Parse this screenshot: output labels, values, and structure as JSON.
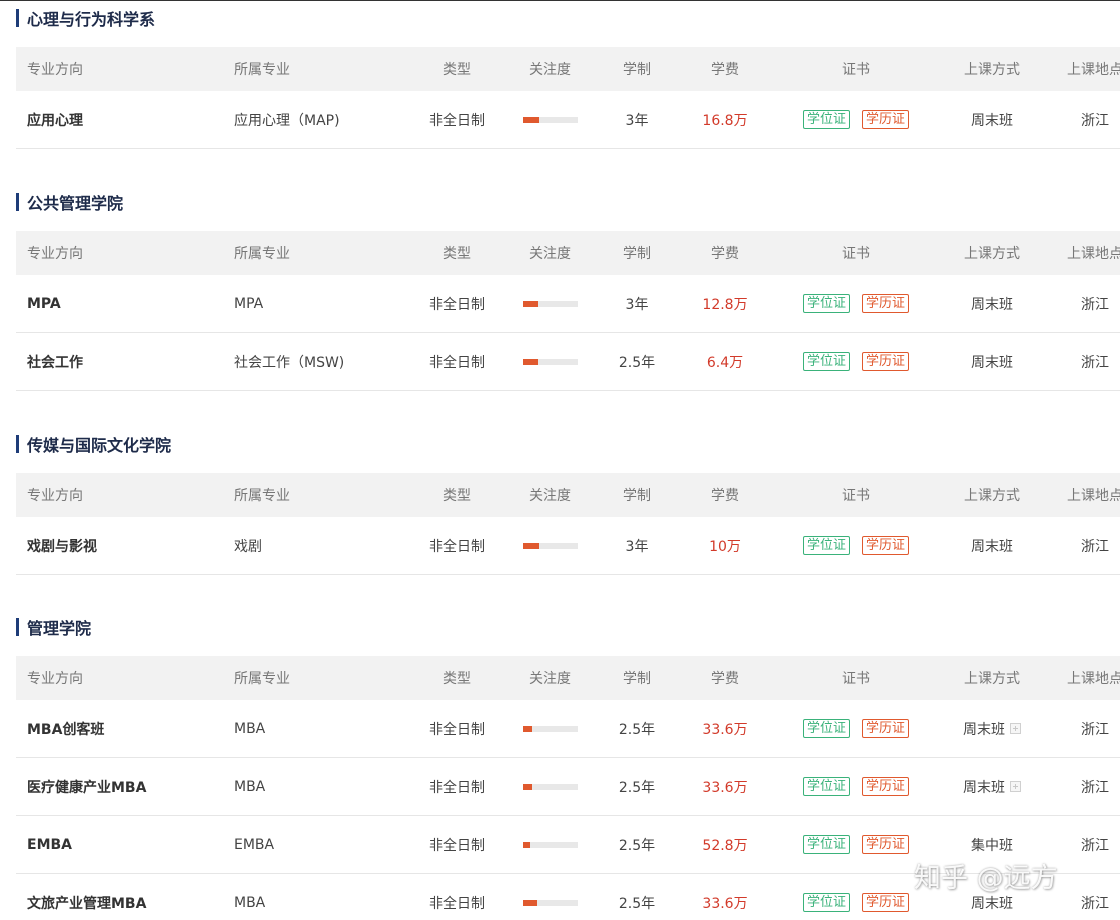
{
  "headers": {
    "direction": "专业方向",
    "major": "所属专业",
    "type": "类型",
    "attention": "关注度",
    "duration": "学制",
    "fee": "学费",
    "certificate": "证书",
    "class_mode": "上课方式",
    "location": "上课地点"
  },
  "badges": {
    "degree": "学位证",
    "education": "学历证"
  },
  "sections": [
    {
      "title": "心理与行为科学系",
      "rows": [
        {
          "direction": "应用心理",
          "major": "应用心理（MAP)",
          "type": "非全日制",
          "attention": 0.3,
          "duration": "3年",
          "fee": "16.8万",
          "class_mode": "周末班",
          "location": "浙江"
        }
      ]
    },
    {
      "title": "公共管理学院",
      "rows": [
        {
          "direction": "MPA",
          "major": "MPA",
          "type": "非全日制",
          "attention": 0.28,
          "duration": "3年",
          "fee": "12.8万",
          "class_mode": "周末班",
          "location": "浙江"
        },
        {
          "direction": "社会工作",
          "major": "社会工作（MSW)",
          "type": "非全日制",
          "attention": 0.28,
          "duration": "2.5年",
          "fee": "6.4万",
          "class_mode": "周末班",
          "location": "浙江"
        }
      ]
    },
    {
      "title": "传媒与国际文化学院",
      "rows": [
        {
          "direction": "戏剧与影视",
          "major": "戏剧",
          "type": "非全日制",
          "attention": 0.3,
          "duration": "3年",
          "fee": "10万",
          "class_mode": "周末班",
          "location": "浙江"
        }
      ]
    },
    {
      "title": "管理学院",
      "rows": [
        {
          "direction": "MBA创客班",
          "major": "MBA",
          "type": "非全日制",
          "attention": 0.18,
          "duration": "2.5年",
          "fee": "33.6万",
          "class_mode": "周末班",
          "location": "浙江"
        },
        {
          "direction": "医疗健康产业MBA",
          "major": "MBA",
          "type": "非全日制",
          "attention": 0.18,
          "duration": "2.5年",
          "fee": "33.6万",
          "class_mode": "周末班",
          "location": "浙江"
        },
        {
          "direction": "EMBA",
          "major": "EMBA",
          "type": "非全日制",
          "attention": 0.14,
          "duration": "2.5年",
          "fee": "52.8万",
          "class_mode": "集中班",
          "location": "浙江"
        },
        {
          "direction": "文旅产业管理MBA",
          "major": "MBA",
          "type": "非全日制",
          "attention": 0.26,
          "duration": "2.5年",
          "fee": "33.6万",
          "class_mode": "周末班",
          "location": "浙江"
        }
      ]
    }
  ],
  "watermark": "知乎 @远方"
}
